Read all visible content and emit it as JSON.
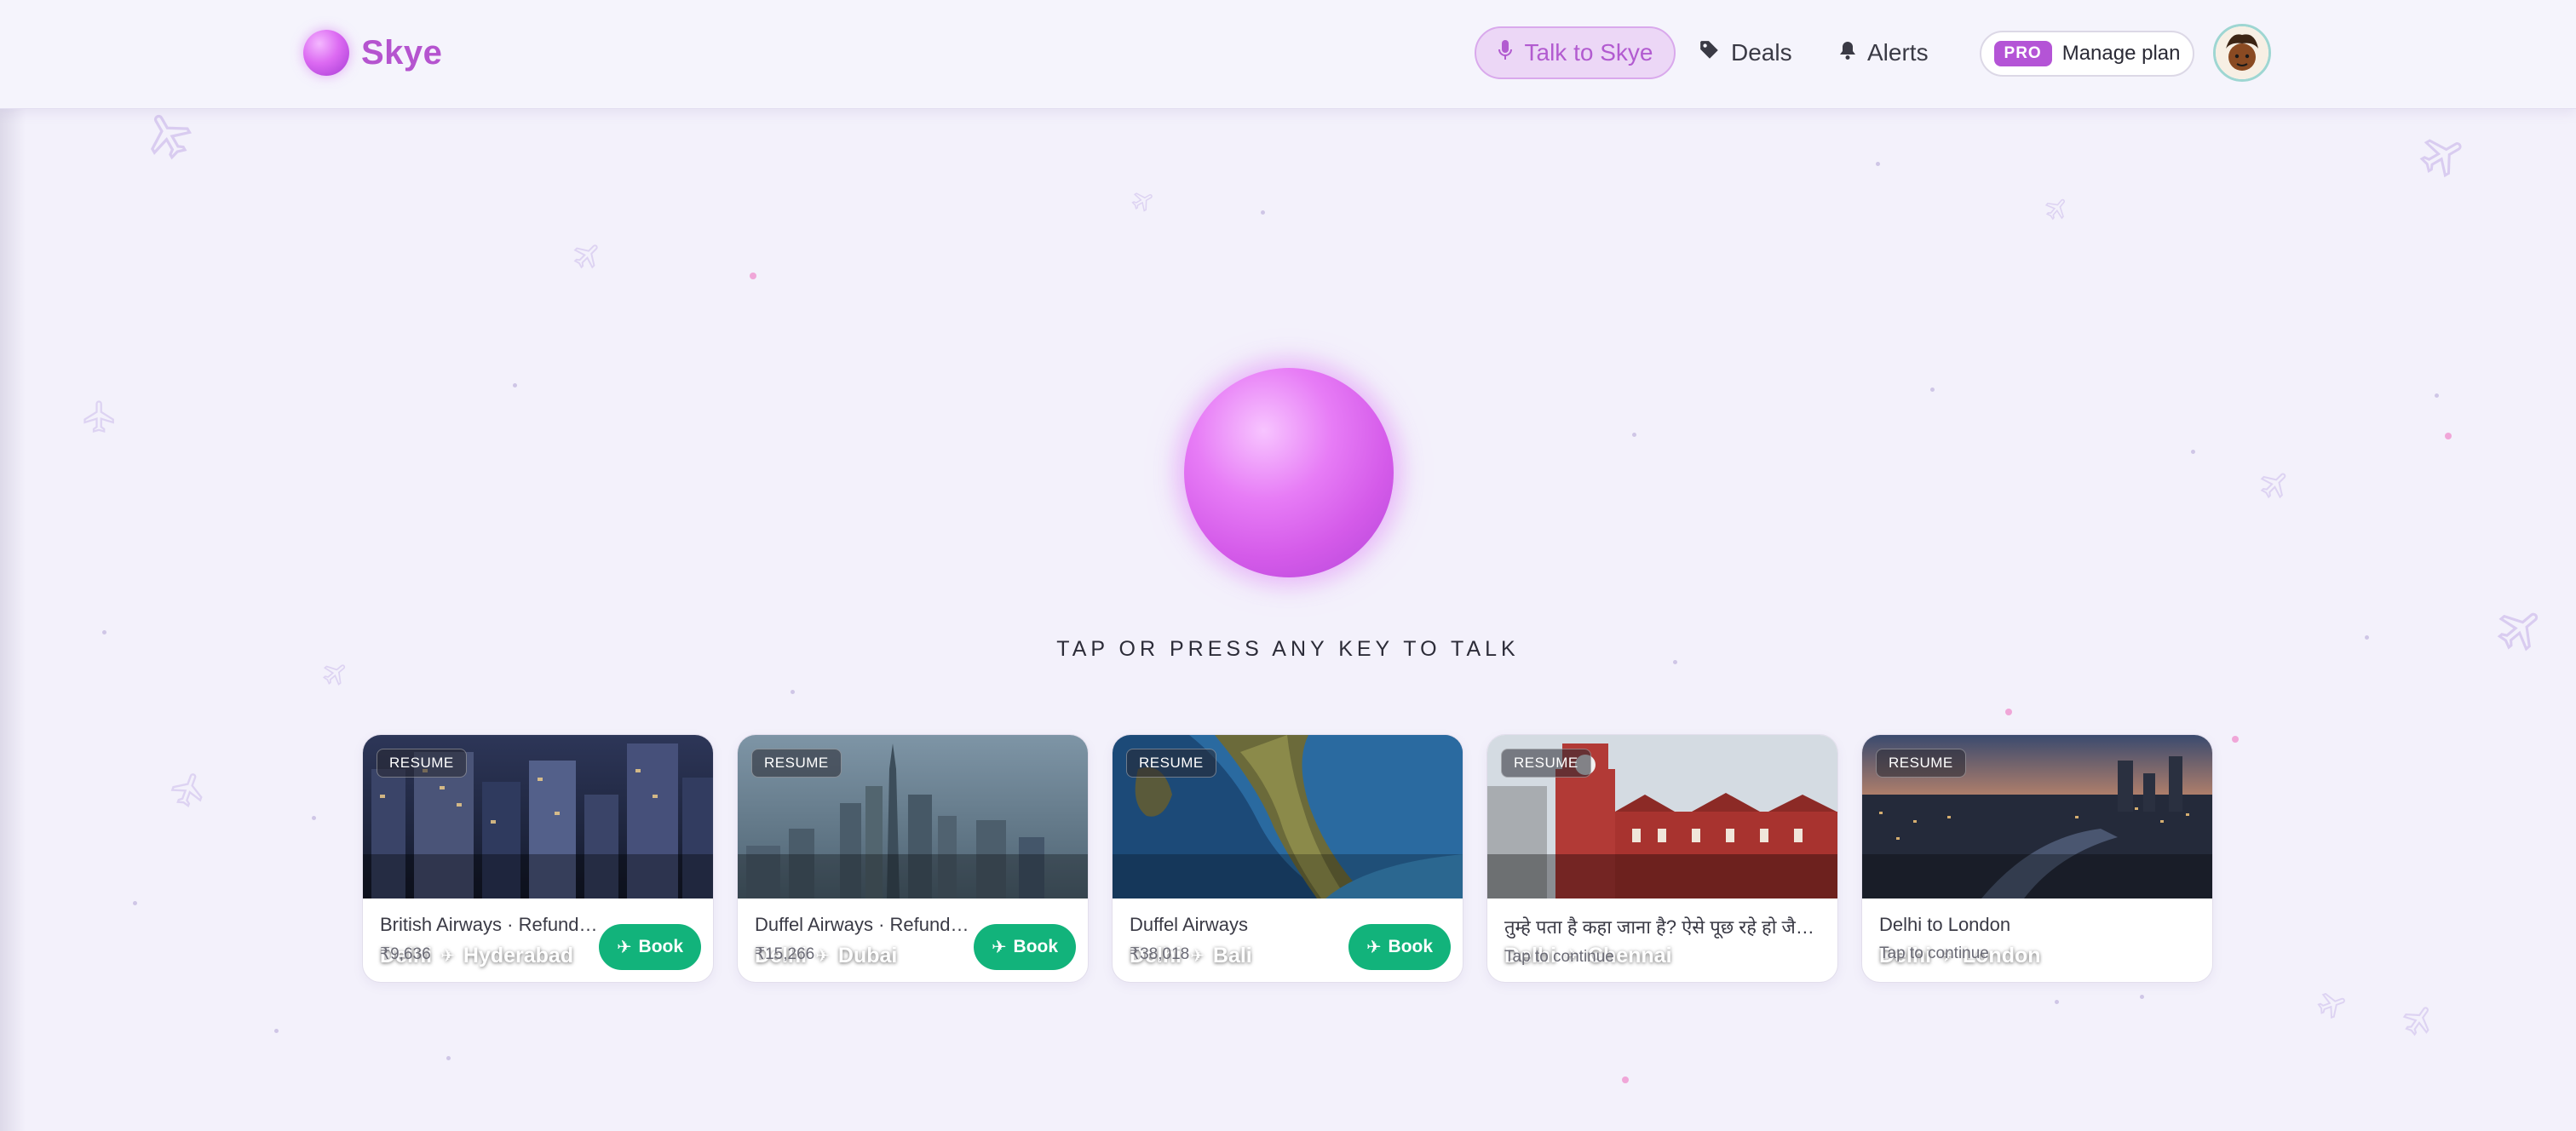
{
  "header": {
    "logo_text": "Skye",
    "talk_label": "Talk to Skye",
    "deals_label": "Deals",
    "alerts_label": "Alerts",
    "pro_badge": "PRO",
    "manage_label": "Manage plan"
  },
  "main": {
    "prompt": "TAP OR PRESS ANY KEY TO TALK"
  },
  "cards": [
    {
      "badge": "RESUME",
      "from": "Delhi",
      "to": "Hyderabad",
      "title": "British Airways · Refunda...",
      "sub": "₹9,636",
      "book": "Book"
    },
    {
      "badge": "RESUME",
      "from": "Delhi",
      "to": "Dubai",
      "title": "Duffel Airways · Refunda...",
      "sub": "₹15,266",
      "book": "Book"
    },
    {
      "badge": "RESUME",
      "from": "Delhi",
      "to": "Bali",
      "title": "Duffel Airways",
      "sub": "₹38,018",
      "book": "Book"
    },
    {
      "badge": "RESUME",
      "from": "Delhi",
      "to": "Chennai",
      "title": "तुम्हे पता है कहा जाना है? ऐसे पूछ रहे हो जैसे ...",
      "sub": "Tap to continue"
    },
    {
      "badge": "RESUME",
      "from": "Delhi",
      "to": "London",
      "title": "Delhi to London",
      "sub": "Tap to continue"
    }
  ],
  "colors": {
    "accent": "#b554cf",
    "book_green": "#12b37b",
    "background": "#f3f1fb"
  },
  "icons": [
    "mic-icon",
    "tag-icon",
    "bell-icon",
    "plane-icon",
    "avatar"
  ]
}
